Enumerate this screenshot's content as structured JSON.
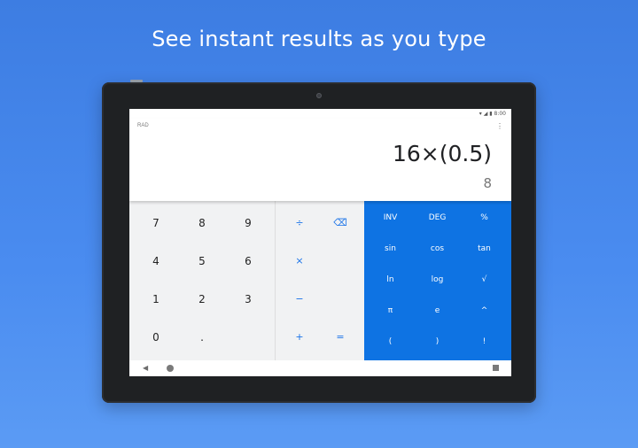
{
  "headline": "See instant results as you type",
  "status": {
    "time": "8:00"
  },
  "display": {
    "mode": "RAD",
    "expression": "16×(0.5)",
    "result": "8",
    "overflow_icon": "⋮"
  },
  "numpad": [
    "7",
    "8",
    "9",
    "4",
    "5",
    "6",
    "1",
    "2",
    "3",
    "0",
    "."
  ],
  "ops": {
    "divide": "÷",
    "backspace": "⌫",
    "multiply": "×",
    "minus": "−",
    "plus": "+",
    "equals": "="
  },
  "adv": [
    "INV",
    "DEG",
    "%",
    "sin",
    "cos",
    "tan",
    "ln",
    "log",
    "√",
    "π",
    "e",
    "^",
    "(",
    ")",
    "!"
  ],
  "nav": {
    "back": "◀"
  },
  "colors": {
    "accent": "#0e73e3",
    "background": "#4a8cf0"
  }
}
